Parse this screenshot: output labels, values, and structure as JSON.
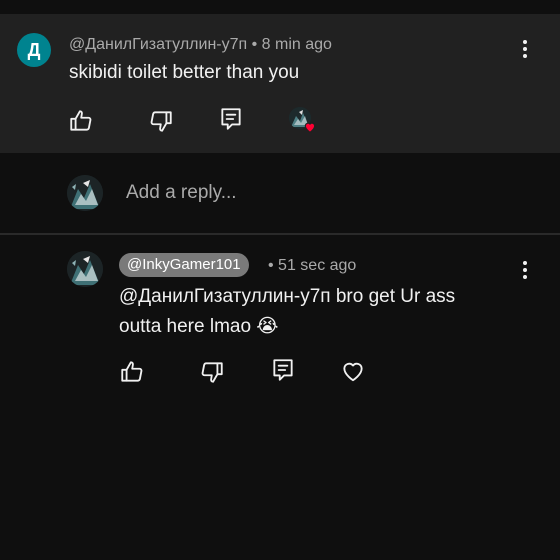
{
  "comment": {
    "avatar_letter": "Д",
    "author": "@ДанилГизатуллин-у7п",
    "time": "• 8 min ago",
    "text": "skibidi toilet better than you"
  },
  "reply_box": {
    "placeholder": "Add a reply..."
  },
  "reply": {
    "author": "@InkyGamer101",
    "time": "• 51 sec ago",
    "text_line1": "@ДанилГизатуллин-у7п bro get Ur ass",
    "text_line2": "outta here lmao 😭"
  },
  "icons": {
    "like": "thumbs-up-icon",
    "dislike": "thumbs-down-icon",
    "reply": "reply-icon",
    "heart": "heart-icon",
    "more": "more-vert-icon"
  },
  "colors": {
    "background": "#0f0f0f",
    "comment_bg": "#212121",
    "avatar_teal": "#00838f",
    "heart_red": "#ff0033",
    "chip_gray": "#7a7a7a"
  }
}
